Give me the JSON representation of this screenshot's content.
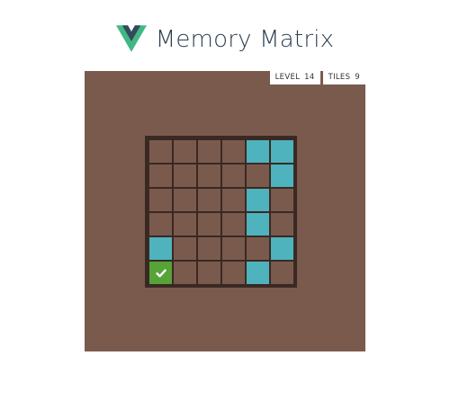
{
  "app": {
    "title": "Memory Matrix",
    "logo_icon": "vue-logo-icon"
  },
  "stats": {
    "level_label": "LEVEL",
    "level_value": "14",
    "tiles_label": "TILES",
    "tiles_value": "9"
  },
  "grid": {
    "rows": 6,
    "cols": 6,
    "tiles": [
      [
        "empty",
        "empty",
        "empty",
        "empty",
        "active",
        "active"
      ],
      [
        "empty",
        "empty",
        "empty",
        "empty",
        "empty",
        "active"
      ],
      [
        "empty",
        "empty",
        "empty",
        "empty",
        "active",
        "empty"
      ],
      [
        "empty",
        "empty",
        "empty",
        "empty",
        "active",
        "empty"
      ],
      [
        "active",
        "empty",
        "empty",
        "empty",
        "empty",
        "active"
      ],
      [
        "correct",
        "empty",
        "empty",
        "empty",
        "active",
        "empty"
      ]
    ]
  },
  "colors": {
    "board": "#7b5a4e",
    "grid_frame": "#3a2923",
    "tile_empty": "#7b5a4e",
    "tile_active": "#4fb3bd",
    "tile_correct": "#56a337",
    "vue_green": "#41b883",
    "vue_dark": "#35495e",
    "title_text": "#2c3e50"
  },
  "icons": {
    "correct_tile": "checkmark-icon"
  }
}
